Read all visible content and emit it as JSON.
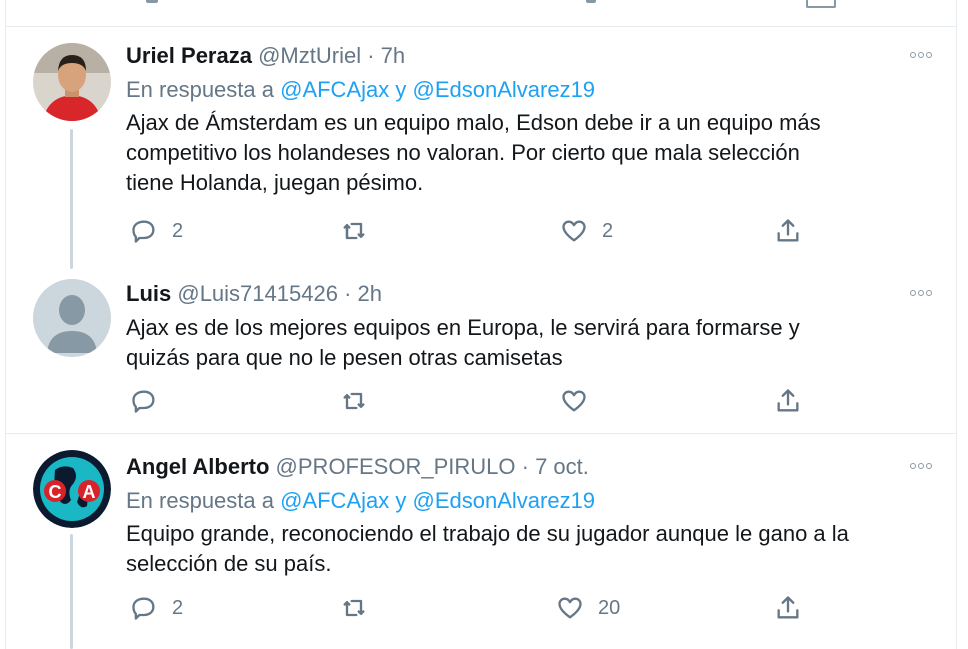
{
  "tweets": [
    {
      "name": "Uriel Peraza",
      "handle": "@MztUriel",
      "dot": "·",
      "time": "7h",
      "reply_prefix": "En respuesta a",
      "reply_to_1": "@AFCAjax",
      "reply_join": "y",
      "reply_to_2": "@EdsonAlvarez19",
      "lines": [
        "Ajax de Ámsterdam es un equipo malo, Edson debe ir a un equipo más",
        "competitivo los holandeses no valoran. Por cierto que mala selección",
        "tiene Holanda, juegan pésimo."
      ],
      "replies": "2",
      "retweets": "",
      "likes": "2"
    },
    {
      "name": "Luis",
      "handle": "@Luis71415426",
      "dot": "·",
      "time": "2h",
      "lines": [
        "Ajax es de los mejores equipos  en Europa, le servirá para formarse y",
        "quizás para que no le pesen otras camisetas"
      ],
      "replies": "",
      "retweets": "",
      "likes": ""
    },
    {
      "name": "Angel Alberto",
      "handle": "@PROFESOR_PIRULO",
      "dot": "·",
      "time": "7 oct.",
      "reply_prefix": "En respuesta a",
      "reply_to_1": "@AFCAjax",
      "reply_join": "y",
      "reply_to_2": "@EdsonAlvarez19",
      "lines": [
        "Equipo grande, reconociendo el trabajo de su jugador aunque le gano a la",
        "selección de su país."
      ],
      "replies": "2",
      "retweets": "",
      "likes": "20"
    }
  ],
  "avatar_3_letters": "CA",
  "colors": {
    "accent": "#1da1f2",
    "secondary_text": "#657786",
    "divider": "#e6ecf0"
  },
  "icons": [
    "reply-icon",
    "retweet-icon",
    "like-icon",
    "share-icon",
    "more-icon"
  ]
}
